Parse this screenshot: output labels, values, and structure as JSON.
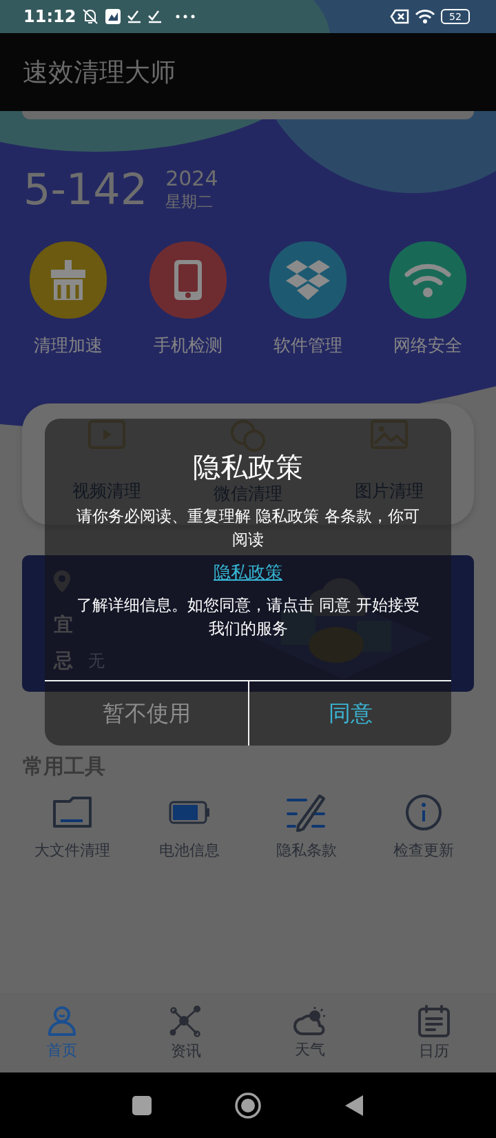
{
  "status_bar": {
    "time": "11:12",
    "battery": "52"
  },
  "app_bar": {
    "title": "速效清理大师"
  },
  "date": {
    "day": "5-142",
    "year": "2024",
    "weekday": "星期二"
  },
  "quick_actions": [
    {
      "label": "清理加速",
      "kind": "broom",
      "color": "#6b5a10"
    },
    {
      "label": "手机检测",
      "kind": "phone",
      "color": "#6e2c30"
    },
    {
      "label": "软件管理",
      "kind": "boxes",
      "color": "#1d5a72"
    },
    {
      "label": "网络安全",
      "kind": "wifi",
      "color": "#186a56"
    }
  ],
  "feature_card": {
    "items": [
      {
        "label": "视频清理",
        "kind": "video"
      },
      {
        "label": "微信清理",
        "kind": "chat"
      },
      {
        "label": "图片清理",
        "kind": "image"
      }
    ]
  },
  "almanac": {
    "good_label": "宜",
    "bad_label": "忌",
    "bad_value": "无"
  },
  "tools": {
    "title": "常用工具",
    "items": [
      {
        "label": "大文件清理",
        "kind": "folder"
      },
      {
        "label": "电池信息",
        "kind": "battery"
      },
      {
        "label": "隐私条款",
        "kind": "notes"
      },
      {
        "label": "检查更新",
        "kind": "info"
      }
    ]
  },
  "bottom_nav": [
    {
      "label": "首页",
      "kind": "user",
      "selected": true
    },
    {
      "label": "资讯",
      "kind": "network",
      "selected": false
    },
    {
      "label": "天气",
      "kind": "weather",
      "selected": false
    },
    {
      "label": "日历",
      "kind": "calendar",
      "selected": false
    }
  ],
  "dialog": {
    "title": "隐私政策",
    "message_1": "请你务必阅读、重复理解 隐私政策 各条款，你可阅读",
    "link": "隐私政策",
    "message_2": "了解详细信息。如您同意，请点击 同意 开始接受我们的服务",
    "buttons": [
      {
        "label": "暂不使用",
        "kind": "cancel"
      },
      {
        "label": "同意",
        "kind": "confirm"
      }
    ]
  }
}
